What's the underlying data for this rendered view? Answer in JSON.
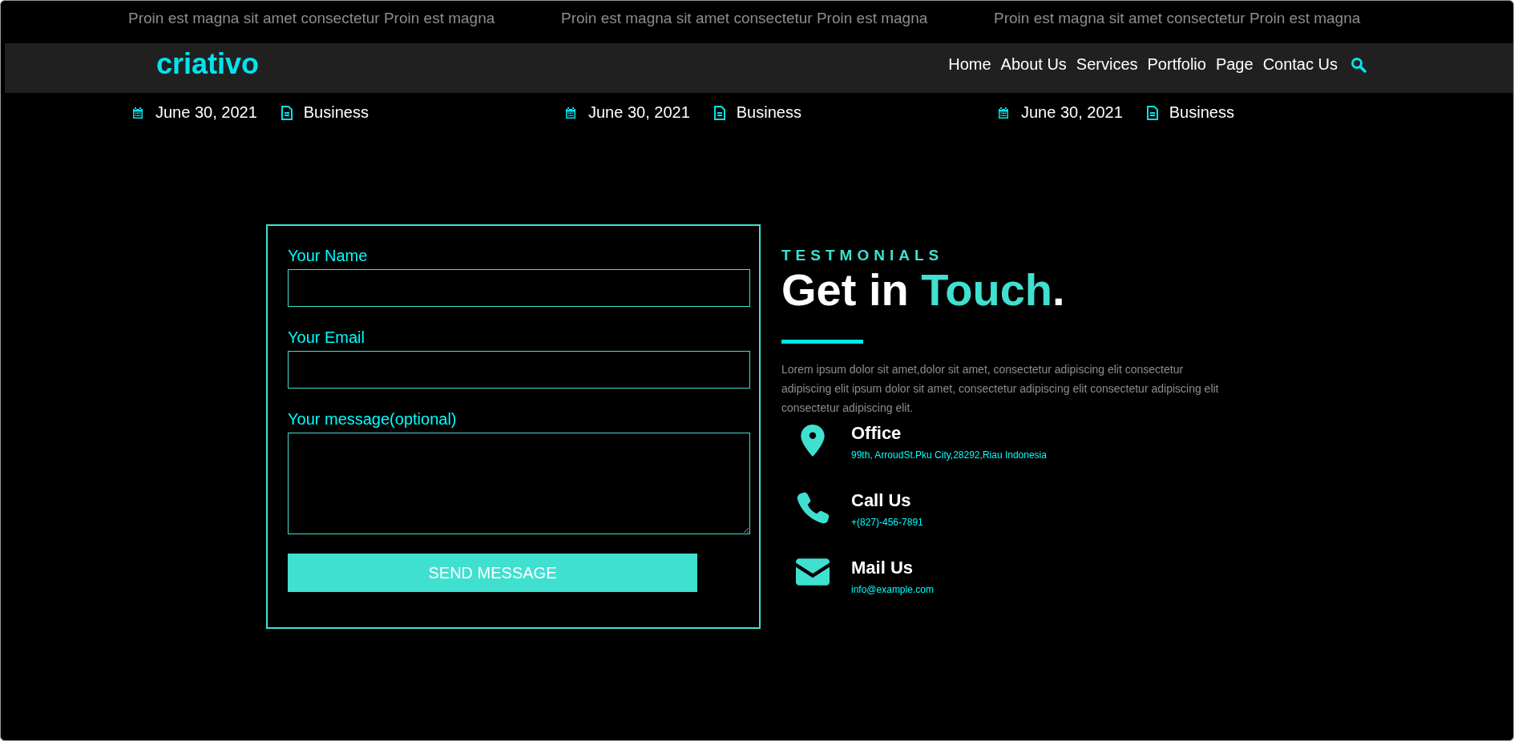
{
  "posts": [
    {
      "excerpt": "Proin est magna sit amet consectetur Proin est magna",
      "date": "June 30, 2021",
      "category": "Business"
    },
    {
      "excerpt": "Proin est magna sit amet consectetur Proin est magna",
      "date": "June 30, 2021",
      "category": "Business"
    },
    {
      "excerpt": "Proin est magna sit amet consectetur Proin est magna",
      "date": "June 30, 2021",
      "category": "Business"
    }
  ],
  "navbar": {
    "logo": "criativo",
    "links": [
      "Home",
      "About Us",
      "Services",
      "Portfolio",
      "Page",
      "Contac Us"
    ]
  },
  "form": {
    "fields": [
      {
        "kind": "input",
        "label": "Your Name"
      },
      {
        "kind": "input",
        "label": "Your Email"
      },
      {
        "kind": "textarea",
        "label": "Your message(optional)"
      }
    ],
    "button": "SEND MESSAGE"
  },
  "contact": {
    "eyebrow": "TESTMONIALS",
    "title": "Get in **Touch**.",
    "text": "Lorem ipsum dolor sit amet,dolor sit amet, consectetur adipiscing elit consectetur adipiscing elit ipsum dolor sit amet, consectetur adipiscing elit consectetur adipiscing elit consectetur adipiscing elit.",
    "items": [
      {
        "kind": "office",
        "title": "Office",
        "detail": "99th, ArroudSt.Pku City,28292,Riau Indonesia"
      },
      {
        "kind": "phone",
        "title": "Call Us",
        "detail": "+(827)-456-7891"
      },
      {
        "kind": "mail",
        "title": "Mail Us",
        "detail": "info@example.com"
      }
    ]
  }
}
